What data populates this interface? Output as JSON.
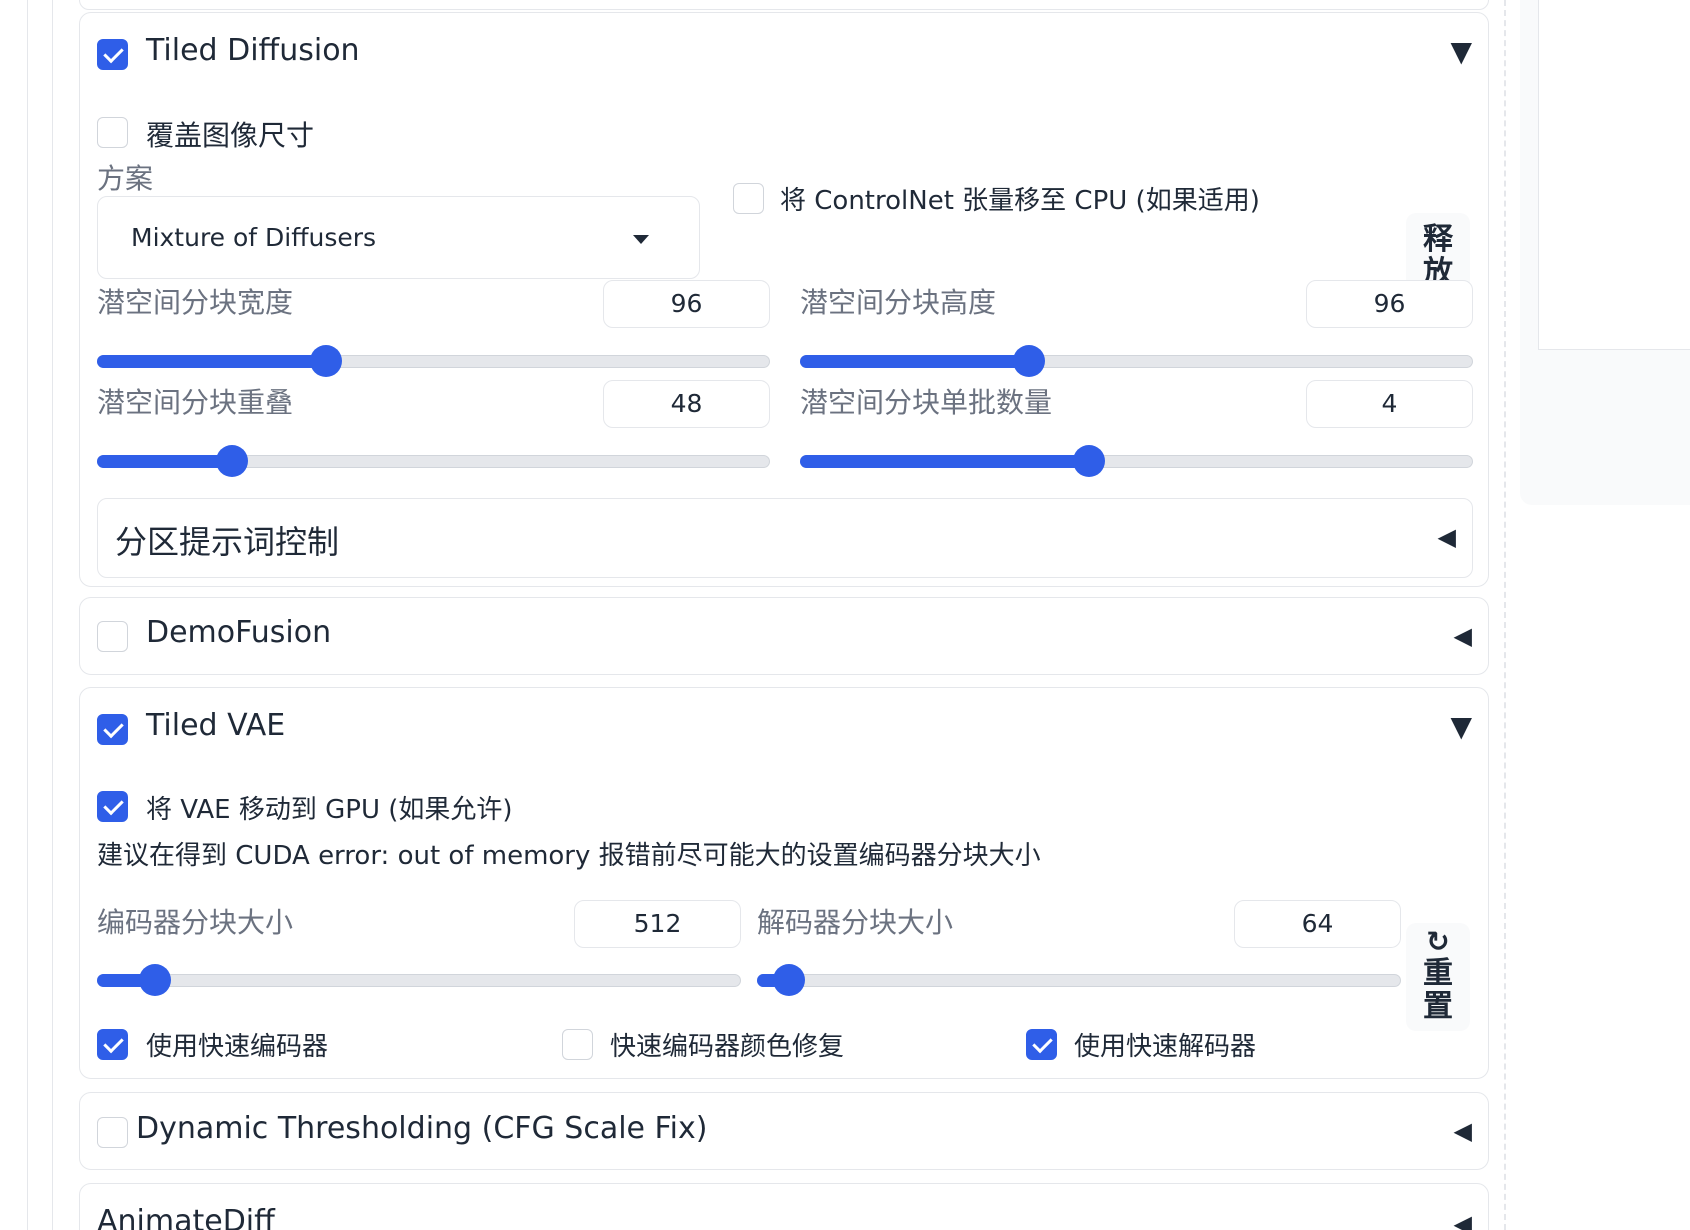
{
  "tiled_diffusion": {
    "title": "Tiled Diffusion",
    "enabled": true,
    "overwrite_size_label": "覆盖图像尺寸",
    "method_label": "方案",
    "method_value": "Mixture of Diffusers",
    "controlnet_cpu_label": "将 ControlNet 张量移至 CPU (如果适用)",
    "free_gpu_button": "释放",
    "latent_tile_width": {
      "label": "潜空间分块宽度",
      "value": "96",
      "fraction": 0.34
    },
    "latent_tile_height": {
      "label": "潜空间分块高度",
      "value": "96",
      "fraction": 0.34
    },
    "latent_tile_overlap": {
      "label": "潜空间分块重叠",
      "value": "48",
      "fraction": 0.2
    },
    "latent_tile_batch": {
      "label": "潜空间分块单批数量",
      "value": "4",
      "fraction": 0.43
    },
    "region_prompt_title": "分区提示词控制"
  },
  "demofusion": {
    "title": "DemoFusion",
    "enabled": false
  },
  "tiled_vae": {
    "title": "Tiled VAE",
    "enabled": true,
    "move_to_gpu_label": "将 VAE 移动到 GPU (如果允许)",
    "hint": "建议在得到 CUDA error: out of memory 报错前尽可能大的设置编码器分块大小",
    "encoder_tile": {
      "label": "编码器分块大小",
      "value": "512",
      "fraction": 0.09
    },
    "decoder_tile": {
      "label": "解码器分块大小",
      "value": "64",
      "fraction": 0.05
    },
    "reset_icon": "↻",
    "reset_button": "重置",
    "fast_encoder_label": "使用快速编码器",
    "fast_encoder_color_fix_label": "快速编码器颜色修复",
    "fast_decoder_label": "使用快速解码器",
    "fast_encoder": true,
    "fast_encoder_color_fix": false,
    "fast_decoder": true
  },
  "dynamic_thresholding": {
    "title": "Dynamic Thresholding (CFG Scale Fix)",
    "enabled": false
  },
  "animatediff": {
    "title": "AnimateDiff"
  },
  "colors": {
    "accent": "#2f5ee8",
    "border": "#e5e7eb",
    "track": "#e5e7eb"
  },
  "icons": {
    "expanded": "▼",
    "collapsed": "◀"
  }
}
